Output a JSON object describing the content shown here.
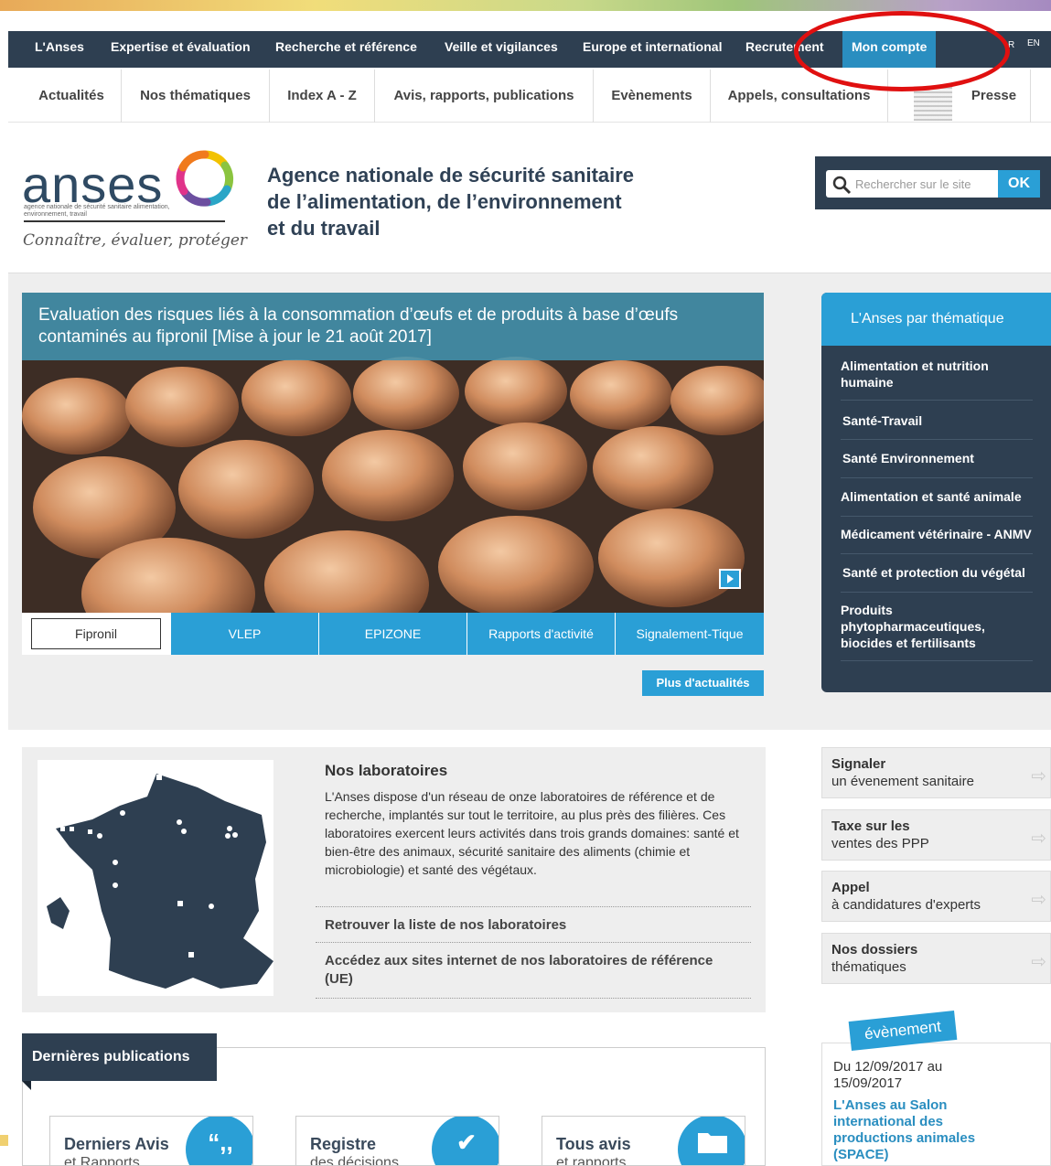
{
  "top_nav": {
    "items": [
      "L'Anses",
      "Expertise et évaluation",
      "Recherche et référence",
      "Veille et vigilances",
      "Europe et international",
      "Recrutement",
      "Mon compte"
    ],
    "lang_fr": "R",
    "lang_en": "EN"
  },
  "sec_nav": {
    "items": [
      "Actualités",
      "Nos thématiques",
      "Index A - Z",
      "Avis, rapports, publications",
      "Evènements",
      "Appels, consultations",
      "Presse"
    ]
  },
  "header": {
    "logo": "anses",
    "logo_sub": "agence nationale de sécurité sanitaire alimentation, environnement, travail",
    "tagline": "Connaître, évaluer, protéger",
    "agency_lines": [
      "Agence nationale de sécurité sanitaire",
      "de l’alimentation, de l’environnement",
      "et du travail"
    ]
  },
  "search": {
    "placeholder": "Rechercher sur le site",
    "button": "OK"
  },
  "hero": {
    "title": "Evaluation des risques liés à la consommation d’œufs et de produits à base d’œufs contaminés au fipronil [Mise à jour le 21 août 2017]",
    "tabs": [
      "Fipronil",
      "VLEP",
      "EPIZONE",
      "Rapports d'activité",
      "Signalement-Tique"
    ],
    "more": "Plus d'actualités"
  },
  "themes": {
    "title": "L'Anses par thématique",
    "items": [
      "Alimentation et nutrition humaine",
      "Santé-Travail",
      "Santé Environnement",
      "Alimentation et santé animale",
      "Médicament vétérinaire - ANMV",
      "Santé et protection du végétal",
      "Produits phytopharmaceutiques, biocides et fertilisants"
    ]
  },
  "labs": {
    "title": "Nos laboratoires",
    "text": "L'Anses dispose d'un réseau de onze laboratoires de référence et de recherche, implantés sur tout le territoire, au plus près des filières. Ces laboratoires exercent leurs activités dans trois grands domaines: santé et bien-être des animaux, sécurité sanitaire des aliments (chimie et microbiologie) et santé des végétaux.",
    "link1": "Retrouver la liste de nos laboratoires",
    "link2": "Accédez aux sites internet de nos laboratoires de référence (UE)"
  },
  "side_links": [
    {
      "title": "Signaler",
      "sub": "un évenement sanitaire"
    },
    {
      "title": "Taxe sur les",
      "sub": "ventes des PPP"
    },
    {
      "title": "Appel",
      "sub": "à candidatures d'experts"
    },
    {
      "title": "Nos dossiers",
      "sub": "thématiques"
    }
  ],
  "event": {
    "tag": "évènement",
    "date": "Du 12/09/2017 au 15/09/2017",
    "link": "L'Anses au Salon international des productions animales (SPACE)"
  },
  "publications": {
    "title": "Dernières publications",
    "cards": [
      {
        "title": "Derniers Avis",
        "sub": "et Rapports"
      },
      {
        "title": "Registre",
        "sub": "des décisions"
      },
      {
        "title": "Tous avis",
        "sub": "et rapports"
      }
    ]
  },
  "colors": {
    "navy": "#2e3f51",
    "blue": "#2a9fd6",
    "annotation": "#e01010"
  },
  "icons": [
    "search-icon",
    "quote-icon",
    "checkmark-icon",
    "folder-icon",
    "arrow-right-icon",
    "play-next-icon"
  ]
}
